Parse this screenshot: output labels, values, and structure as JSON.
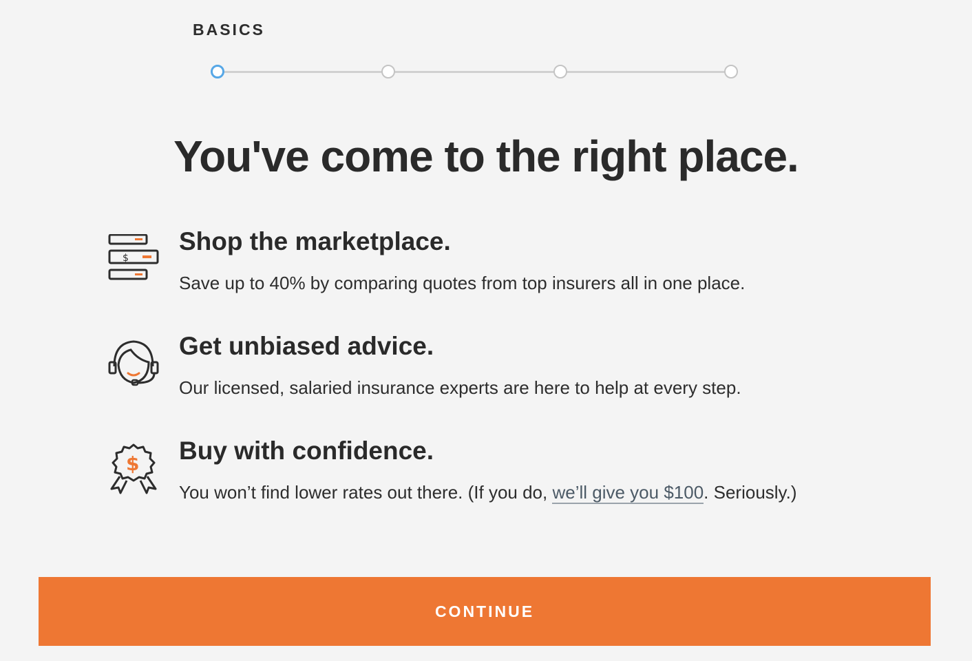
{
  "step": {
    "label": "BASICS",
    "total": 4,
    "current": 1
  },
  "headline": "You've come to the right place.",
  "features": [
    {
      "icon": "marketplace-icon",
      "title": "Shop the marketplace.",
      "description": "Save up to 40% by comparing quotes from top insurers all in one place."
    },
    {
      "icon": "headset-agent-icon",
      "title": "Get unbiased advice.",
      "description": "Our licensed, salaried insurance experts are here to help at every step."
    },
    {
      "icon": "dollar-badge-icon",
      "title": "Buy with confidence.",
      "description_before": "You won’t find lower rates out there. (If you do, ",
      "link_text": "we’ll give you $100",
      "description_after": ". Seriously.)"
    }
  ],
  "continue_label": "CONTINUE",
  "colors": {
    "accent": "#ee7733",
    "active_step": "#56a7e6",
    "text": "#2d2d2d",
    "background": "#f4f4f4"
  }
}
